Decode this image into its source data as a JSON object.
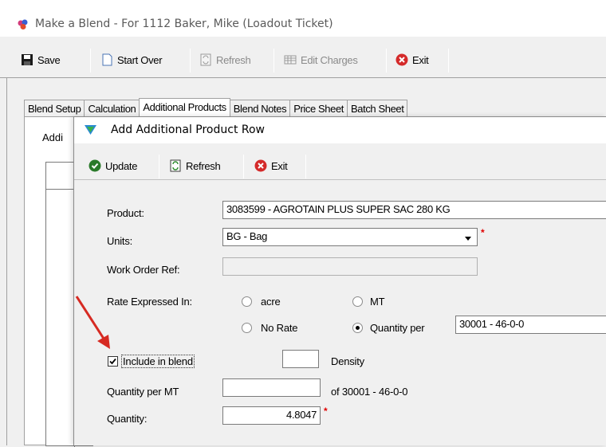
{
  "outer_window": {
    "title": "Make a Blend - For 1112 Baker, Mike (Loadout Ticket)",
    "toolbar": {
      "save": "Save",
      "start_over": "Start Over",
      "refresh": "Refresh",
      "edit_charges": "Edit Charges",
      "exit": "Exit"
    },
    "tabs": [
      "Blend Setup",
      "Calculation",
      "Additional Products",
      "Blend Notes",
      "Price Sheet",
      "Batch Sheet"
    ],
    "panel_label": "Addi"
  },
  "dialog": {
    "title": "Add Additional Product Row",
    "toolbar": {
      "update": "Update",
      "refresh": "Refresh",
      "exit": "Exit"
    },
    "form": {
      "product_label": "Product:",
      "product_value": "3083599 - AGROTAIN PLUS SUPER SAC 280 KG",
      "units_label": "Units:",
      "units_value": "BG - Bag",
      "work_order_label": "Work Order Ref:",
      "work_order_value": "",
      "rate_label": "Rate Expressed In:",
      "rate_options": {
        "acre": "acre",
        "mt": "MT",
        "no_rate": "No Rate",
        "quantity_per": "Quantity per"
      },
      "rate_selected": "Quantity per",
      "quantity_per_value": "30001 - 46-0-0",
      "include_in_blend_label": "Include in blend",
      "include_in_blend_checked": true,
      "density_label": "Density",
      "density_value": "",
      "quantity_per_mt_label": "Quantity per MT",
      "quantity_per_mt_value": "",
      "of_label": "of 30001 - 46-0-0",
      "quantity_label": "Quantity:",
      "quantity_value": "4.8047",
      "required_mark": "*"
    }
  },
  "annotation": {
    "arrow_color": "#d62a22"
  }
}
